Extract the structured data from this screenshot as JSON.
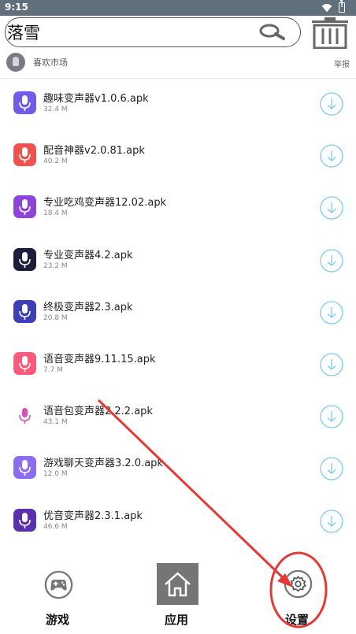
{
  "status_bar": {
    "time": "9:15",
    "wifi_icon": "wifi-icon",
    "battery_icon": "battery-alert-icon"
  },
  "search": {
    "value": "落雪",
    "placeholder": "",
    "search_icon": "search-icon",
    "trash_icon": "trash-icon"
  },
  "user": {
    "name": "喜欢市场",
    "report_label": "举报"
  },
  "files": [
    {
      "name": "趣味变声器v1.0.6.apk",
      "size": "32.4 M",
      "icon": "microphone-app-icon",
      "color": "#6f5ce8"
    },
    {
      "name": "配音神器v2.0.81.apk",
      "size": "40.2 M",
      "icon": "dubbing-app-icon",
      "color": "#ef5350"
    },
    {
      "name": "专业吃鸡变声器12.02.apk",
      "size": "18.4 M",
      "icon": "microphone-app-icon",
      "color": "#8e44d8"
    },
    {
      "name": "专业变声器4.2.apk",
      "size": "23.2 M",
      "icon": "microphone-app-icon",
      "color": "#1a1f3c"
    },
    {
      "name": "终极变声器2.3.apk",
      "size": "20.8 M",
      "icon": "waveform-app-icon",
      "color": "#3d3fb8"
    },
    {
      "name": "语音变声器9.11.15.apk",
      "size": "7.7 M",
      "icon": "bear-app-icon",
      "color": "#ff5a7a"
    },
    {
      "name": "语音包变声器2.2.2.apk",
      "size": "43.1 M",
      "icon": "microphone-app-icon",
      "color": "#ffffff"
    },
    {
      "name": "游戏聊天变声器3.2.0.apk",
      "size": "12.0 M",
      "icon": "chat-mic-app-icon",
      "color": "#8c6cf0"
    },
    {
      "name": "优音变声器2.3.1.apk",
      "size": "46.6 M",
      "icon": "monster-app-icon",
      "color": "#5a2fb0"
    }
  ],
  "download_icon": "download-circle-icon",
  "tabs": [
    {
      "label": "游戏",
      "icon": "gamepad-icon"
    },
    {
      "label": "应用",
      "icon": "home-icon"
    },
    {
      "label": "设置",
      "icon": "gear-icon"
    }
  ],
  "annotation": {
    "color": "#e53935"
  }
}
